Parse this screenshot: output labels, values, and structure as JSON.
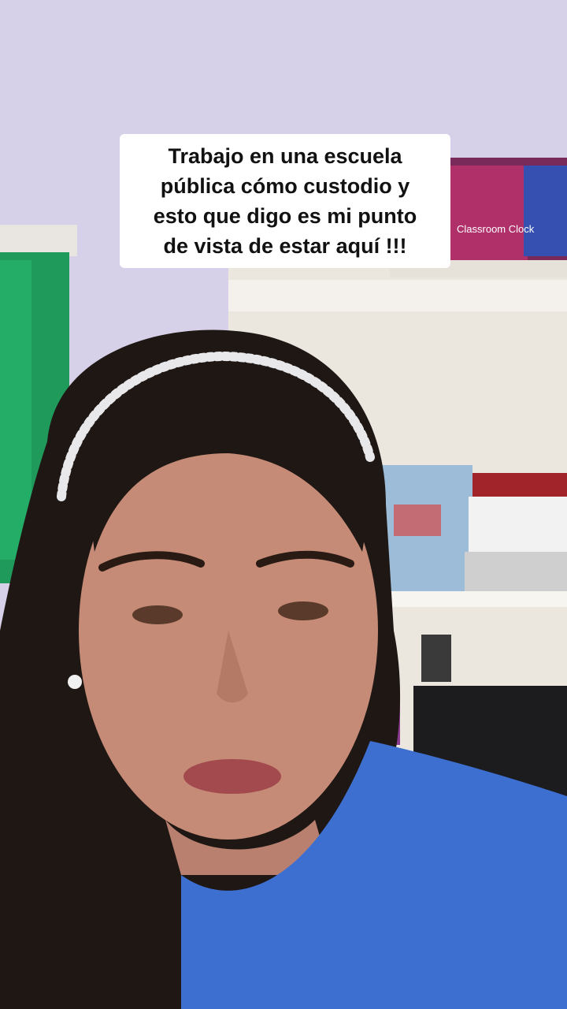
{
  "caption": {
    "lines": [
      "Trabajo en una escuela",
      "pública cómo custodio y",
      "esto que digo es mi punto",
      "de vista de estar aquí !!!"
    ]
  },
  "scene": {
    "wall_color": "#d6d0e8",
    "shirt_color": "#3d6fd0",
    "box_label": "Classroom Clock"
  }
}
